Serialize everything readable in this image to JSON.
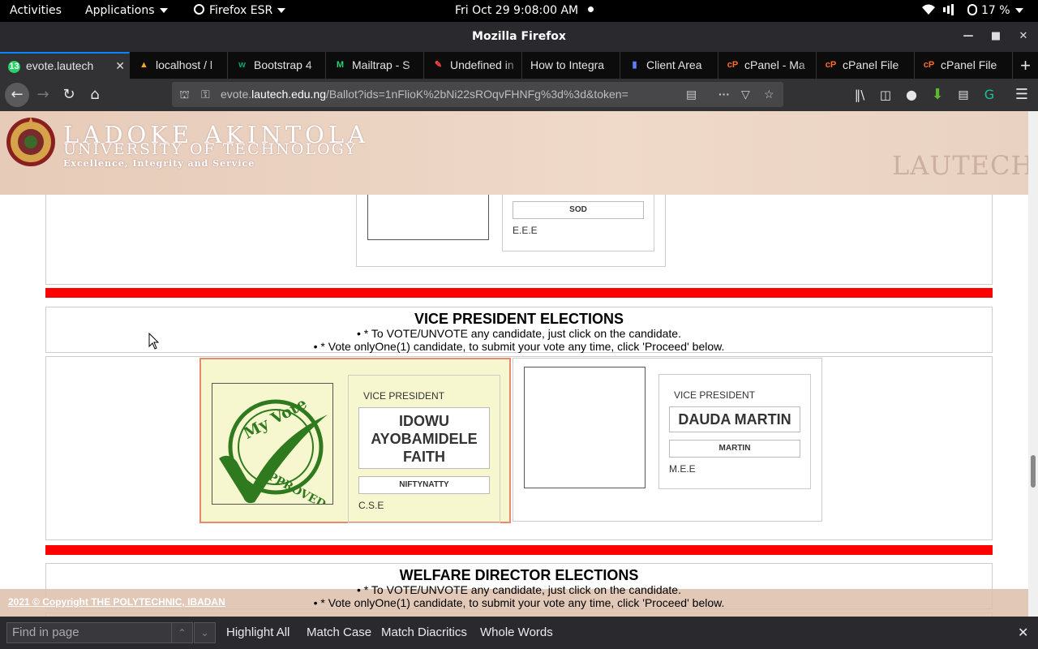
{
  "gnome": {
    "activities": "Activities",
    "applications": "Applications",
    "firefox": "Firefox ESR",
    "clock": "Fri Oct 29  9:08:00 AM",
    "battery": "17 %"
  },
  "window": {
    "title": "Mozilla Firefox"
  },
  "tabs": [
    {
      "label": "evote.lautech",
      "icon": "whatsapp-icon",
      "active": true
    },
    {
      "label": "localhost / l",
      "icon": "phpmyadmin-icon"
    },
    {
      "label": "Bootstrap 4",
      "icon": "w3-icon"
    },
    {
      "label": "Mailtrap - S",
      "icon": "mailtrap-icon"
    },
    {
      "label": "Undefined in",
      "icon": "pen-icon"
    },
    {
      "label": "How to Integra",
      "icon": "none"
    },
    {
      "label": "Client Area",
      "icon": "client-icon"
    },
    {
      "label": "cPanel - Ma",
      "icon": "cpanel-icon"
    },
    {
      "label": "cPanel File",
      "icon": "cpanel-icon"
    },
    {
      "label": "cPanel File",
      "icon": "cpanel-icon"
    }
  ],
  "nav": {
    "url_prefix": "evote.",
    "url_domain": "lautech.edu.ng",
    "url_rest": "/Ballot?ids=1nFlioK%2bNi22sROqvFHNFg%3d%3d&token="
  },
  "banner": {
    "line1": "LADOKE AKINTOLA",
    "line2": "UNIVERSITY OF TECHNOLOGY",
    "motto": "Excellence, Integrity and Service",
    "watermark": "LAUTECH"
  },
  "prev_section": {
    "nickname": "SOD",
    "dept": "E.E.E"
  },
  "vp_section": {
    "title": "VICE PRESIDENT ELECTIONS",
    "instr1": "• * To VOTE/UNVOTE any candidate, just click on the candidate.",
    "instr2": "• * Vote onlyOne(1) candidate, to submit your vote any time, click 'Proceed' below.",
    "candidates": [
      {
        "role": "VICE PRESIDENT",
        "name": "IDOWU AYOBAMIDELE FAITH",
        "nickname": "NIFTYNATTY",
        "dept": "C.S.E",
        "selected": true,
        "stamp_top": "My Vote",
        "stamp_bottom": "APPROVED"
      },
      {
        "role": "VICE PRESIDENT",
        "name": "DAUDA MARTIN",
        "nickname": "MARTIN",
        "dept": "M.E.E",
        "selected": false
      }
    ]
  },
  "welfare_section": {
    "title": "WELFARE DIRECTOR ELECTIONS",
    "instr1": "• * To VOTE/UNVOTE any candidate, just click on the candidate.",
    "instr2": "• * Vote onlyOne(1) candidate, to submit your vote any time, click 'Proceed' below."
  },
  "footer": {
    "copyright": "2021 © Copyright THE POLYTECHNIC, IBADAN"
  },
  "findbar": {
    "placeholder": "Find in page",
    "highlight_all": "Highlight All",
    "match_case": "Match Case",
    "match_diacritics": "Match Diacritics",
    "whole_words": "Whole Words"
  },
  "colors": {
    "accent": "#0a84ff",
    "red_divider": "#ff0000",
    "selected_bg": "#f7f7cf",
    "selected_border": "#e98a6e",
    "stamp_green": "#2f7a1e"
  }
}
